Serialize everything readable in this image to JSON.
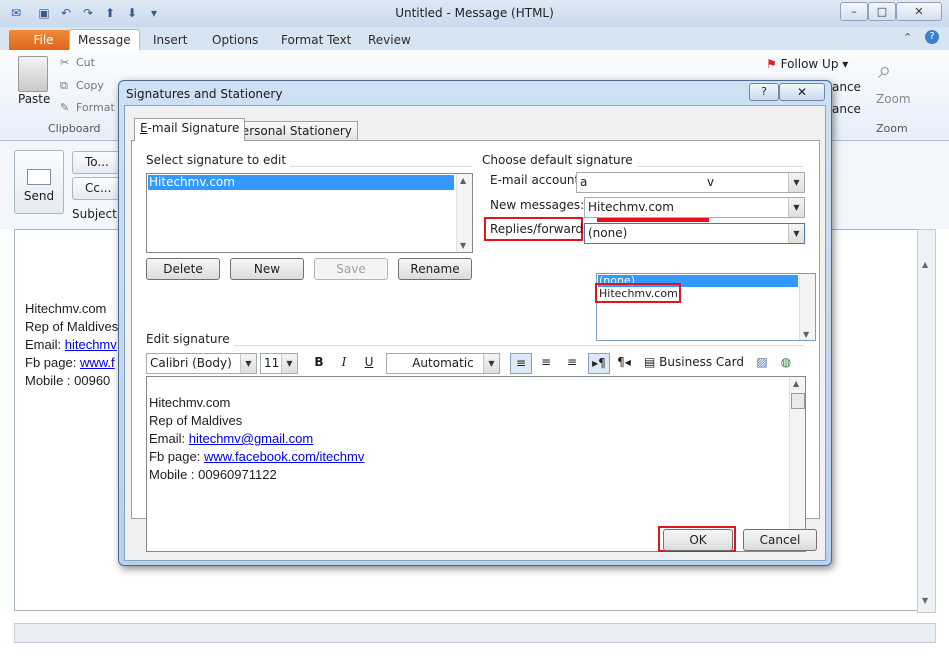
{
  "window": {
    "title": "Untitled  -  Message (HTML)",
    "controls": {
      "minimize": "–",
      "maximize": "□",
      "close": "✕"
    }
  },
  "ribbon": {
    "tabs": [
      "File",
      "Message",
      "Insert",
      "Options",
      "Format Text",
      "Review"
    ],
    "clipboard": {
      "paste": "Paste",
      "cut": "Cut",
      "copy": "Copy",
      "format_painter": "Format",
      "group": "Clipboard"
    },
    "follow_up": "Follow Up",
    "zoom": {
      "label": "Zoom",
      "group": "Zoom"
    },
    "partial_right": [
      "ance",
      "ance"
    ]
  },
  "compose": {
    "send": "Send",
    "to": "To...",
    "cc": "Cc...",
    "subject_label": "Subject:",
    "body_lines": {
      "l1": "Hitechmv.com",
      "l2": "Rep of Maldives",
      "l3_prefix": "Email: ",
      "l3_link": "hitechmv",
      "l4_prefix": "Fb page: ",
      "l4_link": "www.f",
      "l5": "Mobile : 00960"
    }
  },
  "dialog": {
    "title": "Signatures and Stationery",
    "help": "?",
    "close": "✕",
    "tabs": {
      "email_prefix": "E",
      "email_rest": "-mail Signature",
      "stationery": "Personal Stationery"
    },
    "select_label": "Select signature to edit",
    "signatures": [
      "Hitechmv.com"
    ],
    "buttons": {
      "delete": "Delete",
      "new": "New",
      "save": "Save",
      "rename": "Rename",
      "ok": "OK",
      "cancel": "Cancel"
    },
    "default_label": "Choose default signature",
    "email_account_label": "E-mail account:",
    "email_account_value_prefix": "a",
    "email_account_value_suffix": "v",
    "new_messages_label": "New messages:",
    "new_messages_value": "Hitechmv.com",
    "replies_label": "Replies/forwards:",
    "replies_value": "(none)",
    "replies_options": [
      "(none)",
      "Hitechmv.com"
    ],
    "edit_label": "Edit signature",
    "toolbar": {
      "font": "Calibri (Body)",
      "size": "11",
      "bold": "B",
      "italic": "I",
      "underline": "U",
      "color": "Automatic",
      "business_card": "Business Card"
    },
    "signature_text": {
      "line1": "Hitechmv.com",
      "line2": "Rep of Maldives",
      "line3_prefix": "Email: ",
      "line3_link": "hitechmv@gmail.com",
      "line4_prefix": "Fb page: ",
      "line4_link": "www.facebook.com/itechmv",
      "line5": "Mobile : 00960971122"
    },
    "highlight_color": "#e0151d",
    "selection_color": "#3399ff"
  }
}
